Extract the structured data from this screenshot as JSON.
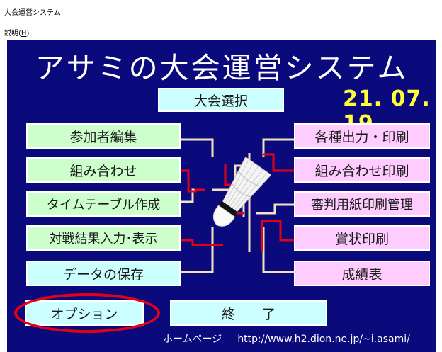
{
  "window": {
    "title": "大会運営システム"
  },
  "menubar": {
    "help_label": "説明(",
    "help_accel": "H",
    "help_close": ")"
  },
  "app": {
    "title": "アサミの大会運営システム",
    "date": "21. 07. 19"
  },
  "buttons": {
    "select_tournament": "大会選択",
    "participants": "参加者編集",
    "pairings": "組み合わせ",
    "timetable": "タイムテーブル作成",
    "results": "対戦結果入力･表示",
    "save_data": "データの保存",
    "options": "オプション",
    "exit": "終　　了",
    "outputs": "各種出力・印刷",
    "print_pairings": "組み合わせ印刷",
    "referee_sheets": "審判用紙印刷管理",
    "award_print": "賞状印刷",
    "grades": "成績表"
  },
  "footer": {
    "homepage_label": "ホームページ",
    "homepage_url": "http://www.h2.dion.ne.jp/~i.asami/"
  },
  "colors": {
    "background": "#0a0a7c",
    "title_text": "#ffffff",
    "date_text": "#ffff3a",
    "green_button": "#ccffcc",
    "cyan_button": "#ccffff",
    "pink_button": "#ffccff",
    "connector_red": "#e60012",
    "connector_beige": "#f2e2c0",
    "highlight_oval": "#e60012"
  },
  "icons": {
    "shuttlecock": "shuttlecock-image"
  }
}
